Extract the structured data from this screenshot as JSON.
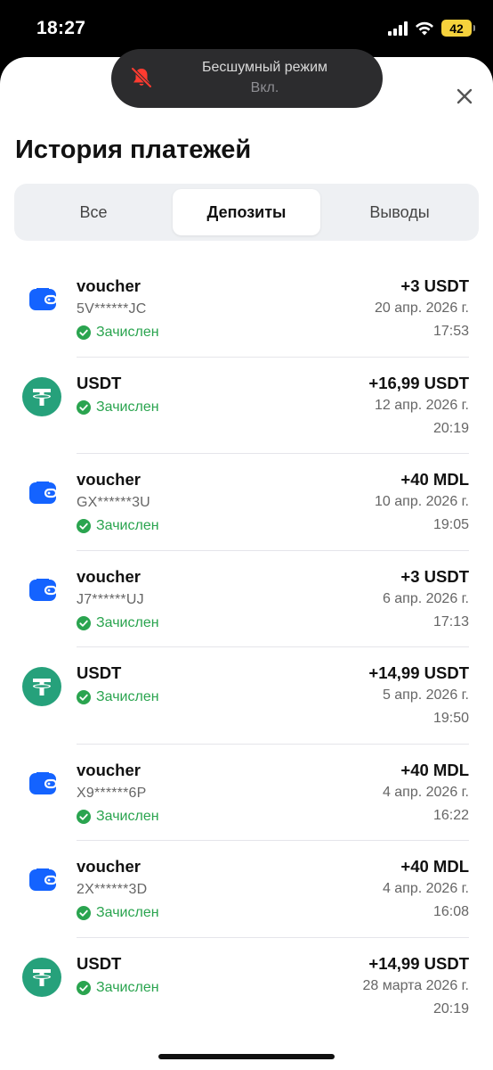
{
  "status_bar": {
    "time": "18:27",
    "battery": "42"
  },
  "toast": {
    "title": "Бесшумный режим",
    "subtitle": "Вкл.",
    "icon": "bell-slash-icon",
    "icon_color": "#ff3b30"
  },
  "header": {
    "title": "История платежей",
    "close_icon": "close-icon"
  },
  "tabs": [
    {
      "label": "Все",
      "active": false
    },
    {
      "label": "Депозиты",
      "active": true
    },
    {
      "label": "Выводы",
      "active": false
    }
  ],
  "colors": {
    "voucher_icon": "#1463ff",
    "usdt_icon": "#26a17b",
    "status_green": "#2aa44f"
  },
  "transactions": [
    {
      "name": "voucher",
      "code": "5V******JC",
      "status": "Зачислен",
      "amount": "+3 USDT",
      "date": "20 апр. 2026 г.",
      "time": "17:53",
      "icon": "wallet-icon"
    },
    {
      "name": "USDT",
      "code": "",
      "status": "Зачислен",
      "amount": "+16,99 USDT",
      "date": "12 апр. 2026 г.",
      "time": "20:19",
      "icon": "tether-icon"
    },
    {
      "name": "voucher",
      "code": "GX******3U",
      "status": "Зачислен",
      "amount": "+40 MDL",
      "date": "10 апр. 2026 г.",
      "time": "19:05",
      "icon": "wallet-icon"
    },
    {
      "name": "voucher",
      "code": "J7******UJ",
      "status": "Зачислен",
      "amount": "+3 USDT",
      "date": "6 апр. 2026 г.",
      "time": "17:13",
      "icon": "wallet-icon"
    },
    {
      "name": "USDT",
      "code": "",
      "status": "Зачислен",
      "amount": "+14,99 USDT",
      "date": "5 апр. 2026 г.",
      "time": "19:50",
      "icon": "tether-icon"
    },
    {
      "name": "voucher",
      "code": "X9******6P",
      "status": "Зачислен",
      "amount": "+40 MDL",
      "date": "4 апр. 2026 г.",
      "time": "16:22",
      "icon": "wallet-icon"
    },
    {
      "name": "voucher",
      "code": "2X******3D",
      "status": "Зачислен",
      "amount": "+40 MDL",
      "date": "4 апр. 2026 г.",
      "time": "16:08",
      "icon": "wallet-icon"
    },
    {
      "name": "USDT",
      "code": "",
      "status": "Зачислен",
      "amount": "+14,99 USDT",
      "date": "28 марта 2026 г.",
      "time": "20:19",
      "icon": "tether-icon"
    }
  ]
}
